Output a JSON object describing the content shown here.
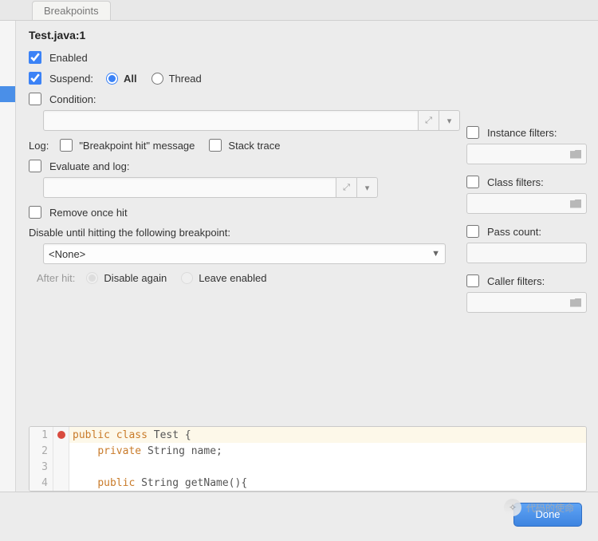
{
  "tab": {
    "label": "Breakpoints"
  },
  "title": "Test.java:1",
  "left": {
    "enabled": {
      "label": "Enabled",
      "checked": true
    },
    "suspend": {
      "label": "Suspend:",
      "checked": true,
      "options": {
        "all": "All",
        "thread": "Thread"
      },
      "selected": "all"
    },
    "condition": {
      "label": "Condition:",
      "checked": false,
      "value": ""
    },
    "log": {
      "label": "Log:",
      "bp_hit": {
        "label": "\"Breakpoint hit\" message",
        "checked": false
      },
      "stack": {
        "label": "Stack trace",
        "checked": false
      }
    },
    "eval": {
      "label": "Evaluate and log:",
      "checked": false,
      "value": ""
    },
    "remove_once": {
      "label": "Remove once hit",
      "checked": false
    },
    "disable_until": {
      "label": "Disable until hitting the following breakpoint:",
      "value": "<None>"
    },
    "after_hit": {
      "label": "After hit:",
      "disable_again": "Disable again",
      "leave_enabled": "Leave enabled"
    }
  },
  "right": {
    "instance_filters": {
      "label": "Instance filters:",
      "checked": false,
      "value": ""
    },
    "class_filters": {
      "label": "Class filters:",
      "checked": false,
      "value": ""
    },
    "pass_count": {
      "label": "Pass count:",
      "checked": false,
      "value": ""
    },
    "caller_filters": {
      "label": "Caller filters:",
      "checked": false,
      "value": ""
    }
  },
  "code": {
    "lines": [
      {
        "n": "1",
        "bp": true,
        "tokens": [
          [
            "kw",
            "public "
          ],
          [
            "kw",
            "class "
          ],
          [
            "plain",
            "Test {"
          ]
        ]
      },
      {
        "n": "2",
        "bp": false,
        "tokens": [
          [
            "plain",
            "    "
          ],
          [
            "kw",
            "private "
          ],
          [
            "plain",
            "String name;"
          ]
        ]
      },
      {
        "n": "3",
        "bp": false,
        "tokens": [
          [
            "plain",
            ""
          ]
        ]
      },
      {
        "n": "4",
        "bp": false,
        "tokens": [
          [
            "plain",
            "    "
          ],
          [
            "kw",
            "public "
          ],
          [
            "plain",
            "String getName(){"
          ]
        ]
      }
    ]
  },
  "footer": {
    "done": "Done"
  },
  "watermark": "代码的使命"
}
